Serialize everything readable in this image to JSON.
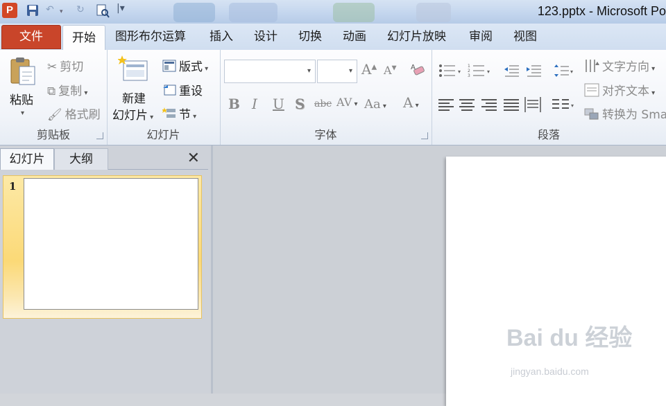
{
  "window": {
    "title": "123.pptx - Microsoft Po",
    "app_icon": "P"
  },
  "ribbon_tabs": [
    "文件",
    "开始",
    "图形布尔运算",
    "插入",
    "设计",
    "切换",
    "动画",
    "幻灯片放映",
    "审阅",
    "视图"
  ],
  "clipboard": {
    "paste": "粘贴",
    "cut": "剪切",
    "copy": "复制",
    "format_painter": "格式刷",
    "label": "剪贴板"
  },
  "slides_group": {
    "new_slide_line1": "新建",
    "new_slide_line2": "幻灯片",
    "layout": "版式",
    "reset": "重设",
    "section": "节",
    "label": "幻灯片"
  },
  "font_group": {
    "label": "字体",
    "bold": "B",
    "italic": "I",
    "underline": "U",
    "shadow": "S",
    "strike": "abc",
    "spacing": "AV",
    "case": "Aa",
    "color": "A"
  },
  "paragraph_group": {
    "label": "段落",
    "text_direction": "文字方向",
    "align_text": "对齐文本",
    "convert_smartart": "转换为 Sma"
  },
  "panel": {
    "tab_slides": "幻灯片",
    "tab_outline": "大纲",
    "close": "✕",
    "slide_number": "1"
  },
  "watermark": {
    "main": "Bai du 经验",
    "url": "jingyan.baidu.com"
  }
}
